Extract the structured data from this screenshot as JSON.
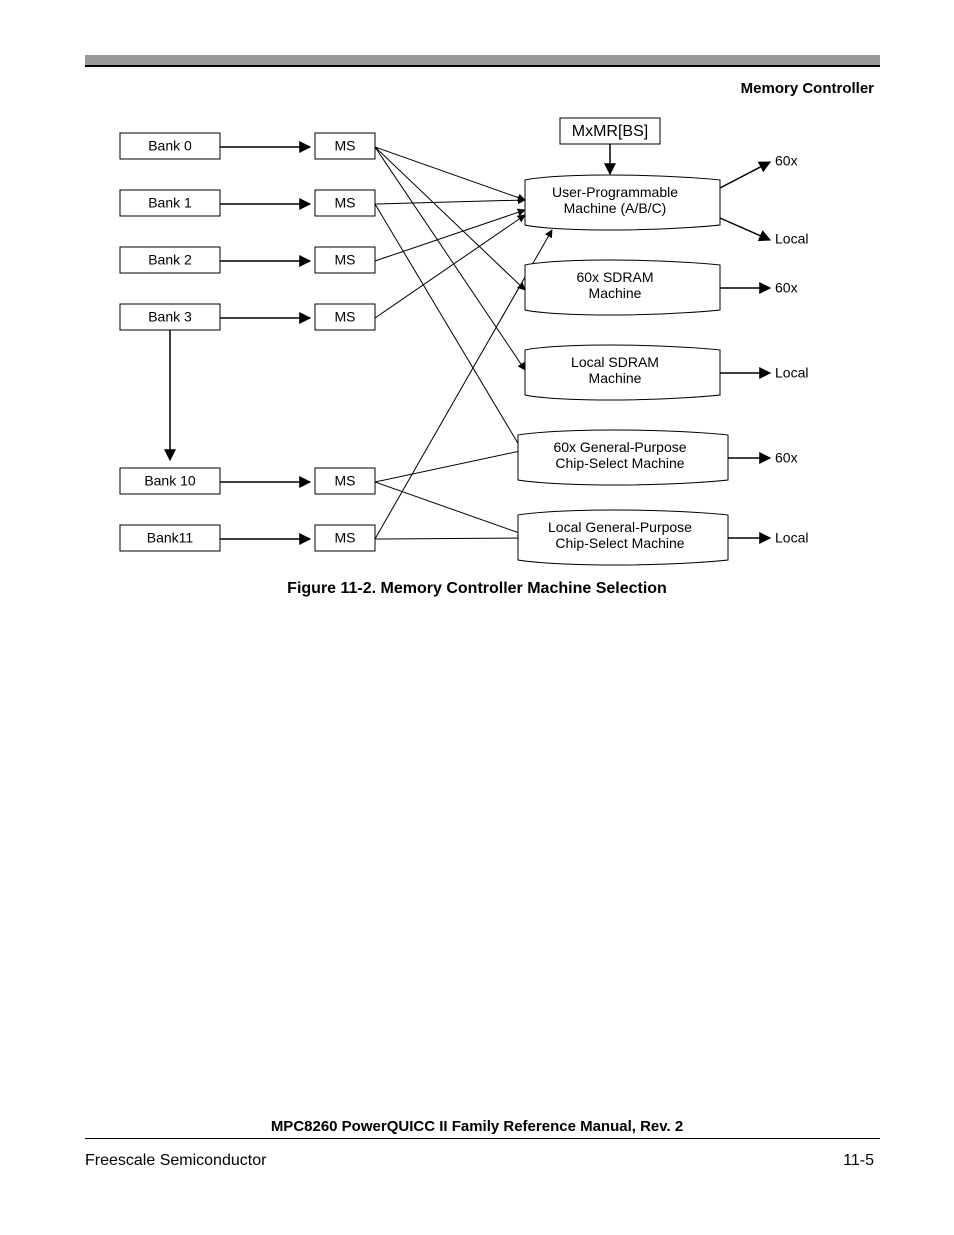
{
  "section_title": "Memory Controller",
  "caption": "Figure 11-2. Memory Controller Machine Selection",
  "footer_title": "MPC8260 PowerQUICC II Family Reference Manual, Rev. 2",
  "footer_left": "Freescale Semiconductor",
  "footer_right": "11-5",
  "top_box": "MxMR[BS]",
  "banks": [
    "Bank 0",
    "Bank 1",
    "Bank 2",
    "Bank 3",
    "Bank 10",
    "Bank11"
  ],
  "ms": "MS",
  "machines": [
    {
      "line1": "User-Programmable",
      "line2": "Machine (A/B/C)",
      "out1": "60x",
      "out2": "Local"
    },
    {
      "line1": "60x SDRAM",
      "line2": "Machine",
      "out1": "60x"
    },
    {
      "line1": "Local SDRAM",
      "line2": "Machine",
      "out1": "Local"
    },
    {
      "line1": "60x General-Purpose",
      "line2": "Chip-Select Machine",
      "out1": "60x"
    },
    {
      "line1": "Local General-Purpose",
      "line2": "Chip-Select Machine",
      "out1": "Local"
    }
  ]
}
